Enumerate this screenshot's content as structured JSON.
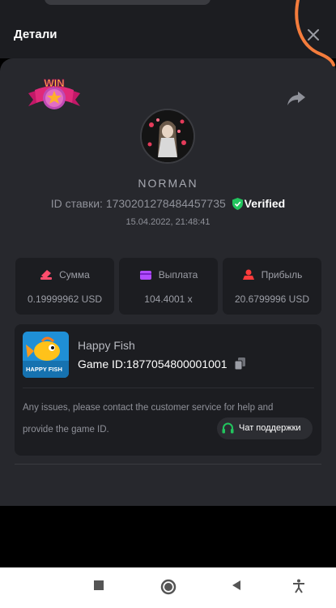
{
  "header": {
    "title": "Детали"
  },
  "win_badge": {
    "text": "WIN"
  },
  "user": {
    "name": "NORMAN"
  },
  "bet": {
    "id_label": "ID ставки:",
    "id": "1730201278484457735",
    "verified": "Verified",
    "datetime": "15.04.2022, 21:48:41"
  },
  "stats": [
    {
      "label": "Сумма",
      "value": "0.19999962 USD",
      "icon": "coins-icon",
      "color": "#ff4d6d"
    },
    {
      "label": "Выплата",
      "value": "104.4001 x",
      "icon": "wallet-icon",
      "color": "#b14cff"
    },
    {
      "label": "Прибыль",
      "value": "20.6799996 USD",
      "icon": "profit-icon",
      "color": "#ff3b3b"
    }
  ],
  "game": {
    "name": "Happy Fish",
    "id_label": "Game ID:",
    "id": "1877054800001001",
    "thumb_text": "HAPPY FISH"
  },
  "notice": "Any issues, please contact the customer service for help and provide the game ID.",
  "support": {
    "label": "Чат поддержки"
  },
  "colors": {
    "verified": "#22c55e",
    "support_icon": "#22c55e",
    "annotation": "#f47c3c"
  }
}
